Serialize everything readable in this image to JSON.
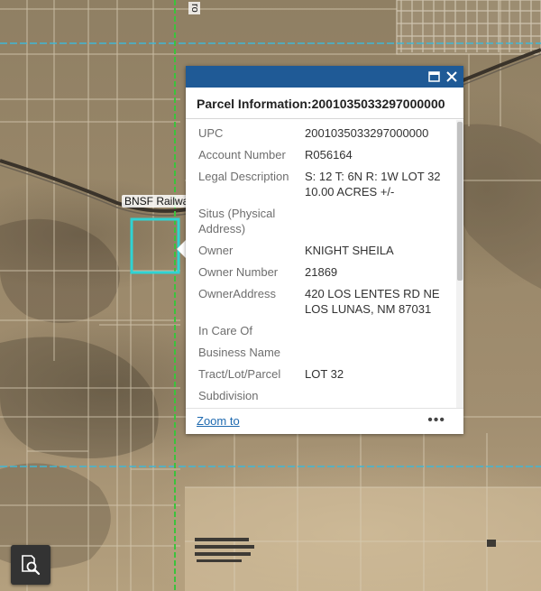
{
  "map": {
    "rail_label": "BNSF Railwa",
    "road_label_fragment": "ro"
  },
  "popup": {
    "title": "Parcel Information:2001035033297000000",
    "fields": [
      {
        "key": "UPC",
        "value": "2001035033297000000"
      },
      {
        "key": "Account Number",
        "value": "R056164"
      },
      {
        "key": "Legal Description",
        "value": "S: 12 T: 6N R: 1W LOT 32 10.00 ACRES +/-"
      },
      {
        "key": "Situs (Physical Address)",
        "value": ""
      },
      {
        "key": "Owner",
        "value": "KNIGHT SHEILA"
      },
      {
        "key": "Owner Number",
        "value": "21869"
      },
      {
        "key": "OwnerAddress",
        "value": "420 LOS LENTES RD NE LOS LUNAS, NM 87031"
      },
      {
        "key": "In Care Of",
        "value": ""
      },
      {
        "key": "Business Name",
        "value": ""
      },
      {
        "key": "Tract/Lot/Parcel",
        "value": "LOT 32"
      },
      {
        "key": "Subdivision",
        "value": ""
      }
    ],
    "zoom_label": "Zoom to",
    "more_label": "•••",
    "icons": {
      "maximize": "maximize-icon",
      "close": "close-icon",
      "more": "ellipsis-icon"
    }
  },
  "tools": {
    "search_icon": "search-document-icon"
  },
  "colors": {
    "header": "#1f5a96",
    "selection": "#2fd3d3",
    "green_line": "#3cc23c",
    "cyan_line": "#3fb8d6",
    "link": "#1f6ab0"
  }
}
